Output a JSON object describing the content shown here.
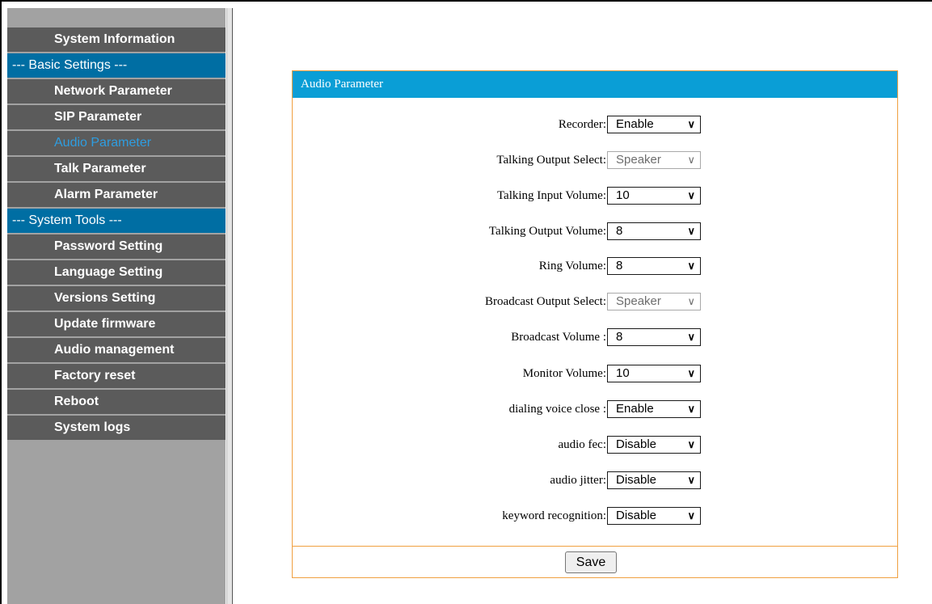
{
  "sidebar": {
    "items": [
      {
        "label": "System Information",
        "type": "item"
      },
      {
        "label": "--- Basic Settings ---",
        "type": "section"
      },
      {
        "label": "Network Parameter",
        "type": "item"
      },
      {
        "label": "SIP Parameter",
        "type": "item"
      },
      {
        "label": "Audio Parameter",
        "type": "active"
      },
      {
        "label": "Talk Parameter",
        "type": "item"
      },
      {
        "label": "Alarm Parameter",
        "type": "item"
      },
      {
        "label": "--- System Tools ---",
        "type": "section"
      },
      {
        "label": "Password Setting",
        "type": "item"
      },
      {
        "label": "Language Setting",
        "type": "item"
      },
      {
        "label": "Versions Setting",
        "type": "item"
      },
      {
        "label": "Update firmware",
        "type": "item"
      },
      {
        "label": "Audio management",
        "type": "item"
      },
      {
        "label": "Factory reset",
        "type": "item"
      },
      {
        "label": "Reboot",
        "type": "item"
      },
      {
        "label": "System logs",
        "type": "item"
      }
    ]
  },
  "panel": {
    "title": "Audio Parameter",
    "fields": [
      {
        "label": "Recorder:",
        "value": "Enable",
        "disabled": false
      },
      {
        "label": "Talking Output Select:",
        "value": "Speaker",
        "disabled": true
      },
      {
        "label": "Talking Input Volume:",
        "value": "10",
        "disabled": false
      },
      {
        "label": "Talking Output Volume:",
        "value": "8",
        "disabled": false
      },
      {
        "label": "Ring Volume:",
        "value": "8",
        "disabled": false
      },
      {
        "label": "Broadcast Output Select:",
        "value": "Speaker",
        "disabled": true
      },
      {
        "label": "Broadcast Volume :",
        "value": "8",
        "disabled": false
      },
      {
        "label": "Monitor Volume:",
        "value": "10",
        "disabled": false
      },
      {
        "label": "dialing voice close :",
        "value": "Enable",
        "disabled": false
      },
      {
        "label": "audio fec:",
        "value": "Disable",
        "disabled": false
      },
      {
        "label": "audio jitter:",
        "value": "Disable",
        "disabled": false
      },
      {
        "label": "keyword recognition:",
        "value": "Disable",
        "disabled": false
      }
    ],
    "save_label": "Save"
  },
  "colors": {
    "sidebar_item_bg": "#5b5b5b",
    "sidebar_section_bg": "#006ea3",
    "sidebar_active_text": "#2e9de0",
    "panel_header_bg": "#0a9ed6",
    "panel_border": "#f0a040"
  },
  "icons": {
    "select_arrow": "chevron-down-icon"
  }
}
